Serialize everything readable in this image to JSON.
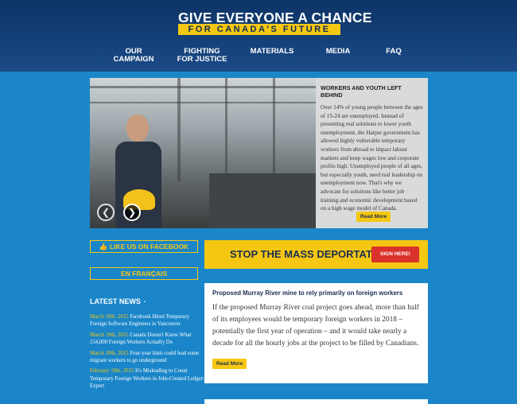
{
  "header": {
    "logo_line1": "GIVE EVERYONE A CHANCE",
    "logo_line2": "FOR CANADA'S FUTURE",
    "nav": [
      "OUR CAMPAIGN",
      "FIGHTING FOR JUSTICE",
      "MATERIALS",
      "MEDIA",
      "FAQ"
    ]
  },
  "hero": {
    "title": "WORKERS AND YOUTH LEFT BEHIND",
    "body": "Over 14% of young people between the ages of 15-24 are unemployed. Instead of presenting real solutions to lower youth unemployment, the Harper government has allowed highly vulnerable temporary workers from abroad to impact labour markets and keep wages low and corporate profits high. Unemployed people of all ages, but especially youth, need real leadership on unemployment now. That's why we advocate for solutions like better job training and economic development based on a high wage model of Canada.",
    "read_more": "Read More",
    "prev_icon": "chevron-left-icon",
    "next_icon": "chevron-right-icon"
  },
  "sidebar": {
    "facebook_button": "LIKE US ON FACEBOOK",
    "french_button": "EN FRANÇAIS",
    "latest_news_title": "LATEST NEWS",
    "news": [
      {
        "date": "March 19th, 2015",
        "title": "Facebook Hired Temporary Foreign Software Engineers in Vancouver"
      },
      {
        "date": "March 19th, 2015",
        "title": "Canada Doesn't Know What 154,000 Foreign Workers Actually Do"
      },
      {
        "date": "March 18th, 2015",
        "title": "Four-year limit could lead some migrant workers to go underground"
      },
      {
        "date": "February 19th, 2015",
        "title": "It's Misleading to Count Temporary Foreign Workers in Jobs-Created Ledger: Expert"
      }
    ]
  },
  "banner": {
    "title": "STOP THE MASS DEPORTATION!",
    "button": "SIGN HERE!"
  },
  "article": {
    "title": "Proposed Murray River mine to rely primarily on foreign workers",
    "body": "If the proposed Murray River coal project goes ahead, more than half of its employees would be temporary foreign workers in 2018 – potentially the first year of operation – and it would take nearly a decade for all the hourly jobs at the project to be filled by Canadians.",
    "read_more": "Read More"
  },
  "colors": {
    "background": "#1a86c9",
    "header": "#0e3466",
    "accent_yellow": "#f6c712",
    "sign_red": "#d9312b"
  }
}
